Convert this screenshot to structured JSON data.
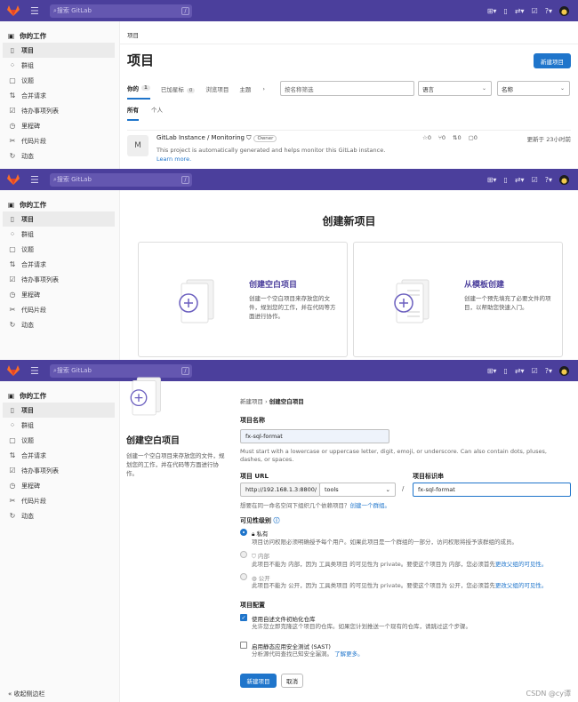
{
  "topbar": {
    "search_placeholder": "搜索 GitLab",
    "search_shortcut": "/"
  },
  "sidebar": {
    "title": "你的工作",
    "items": [
      "项目",
      "群组",
      "议题",
      "合并请求",
      "待办事项列表",
      "里程碑",
      "代码片段",
      "动态"
    ],
    "collapse": "收起侧边栏"
  },
  "projects_page": {
    "breadcrumb": "项目",
    "title": "项目",
    "new_button": "新建项目",
    "tabs": [
      {
        "label": "你的",
        "count": "1"
      },
      {
        "label": "已加星标",
        "count": "0"
      },
      {
        "label": "浏览项目",
        "count": ""
      },
      {
        "label": "主题",
        "count": ""
      }
    ],
    "filter_placeholder": "按名称筛选",
    "language_select": "语言",
    "sort_select": "名称",
    "subtabs": [
      "所有",
      "个人"
    ],
    "project": {
      "avatar": "M",
      "name": "GitLab Instance / Monitoring",
      "role": "Owner",
      "description": "This project is automatically generated and helps monitor this GitLab instance.",
      "learn_more": "Learn more.",
      "stars": "0",
      "forks": "0",
      "merge_requests": "0",
      "issues": "0",
      "updated": "更新于 23小时前"
    }
  },
  "new_project_page": {
    "title": "创建新项目",
    "cards": [
      {
        "title": "创建空白项目",
        "description": "创建一个空白项目来存放您的文件，规划您的工作，并在代码等方面进行协作。"
      },
      {
        "title": "从模板创建",
        "description": "创建一个预先填充了必要文件的项目，以帮助您快速入门。"
      }
    ]
  },
  "blank_project_page": {
    "left_title": "创建空白项目",
    "left_description": "创建一个空白项目来存放您的文件，规划您的工作，并在代码等方面进行协作。",
    "breadcrumb_parent": "新建项目",
    "breadcrumb_current": "创建空白项目",
    "name_label": "项目名称",
    "name_value": "fx-sql-format",
    "name_help": "Must start with a lowercase or uppercase letter, digit, emoji, or underscore. Can also contain dots, pluses, dashes, or spaces.",
    "url_label": "项目 URL",
    "url_prefix": "http://192.168.1.3:8800/",
    "namespace": "tools",
    "slug_label": "项目标识串",
    "slug_value": "fx-sql-format",
    "group_hint": "想要在同一命名空间下组织几个依赖项目？",
    "group_link": "创建一个群组。",
    "visibility_label": "可见性级别",
    "visibility": [
      {
        "label": "私有",
        "description": "项目访问权限必须明确授予每个用户。如果此项目是一个群组的一部分，访问权限将授予该群组的成员。",
        "link": ""
      },
      {
        "label": "内部",
        "description": "此项目不能为 内部，因为 工具类项目 的可见性为 private。要使这个项目为 内部，您必须首先",
        "link": "更改父组的可见性。"
      },
      {
        "label": "公开",
        "description": "此项目不能为 公开，因为 工具类项目 的可见性为 private。要使这个项目为 公开，您必须首先",
        "link": "更改父组的可见性。"
      }
    ],
    "config_label": "项目配置",
    "readme_label": "使用自述文件初始化仓库",
    "readme_help": "允许您立即克隆这个项目的仓库。如果您计划推送一个现有的仓库，请跳过这个步骤。",
    "sast_label": "启用静态应用安全测试 (SAST)",
    "sast_help": "分析源代码查找已知安全漏洞。",
    "sast_link": "了解更多。",
    "create_button": "新建项目",
    "cancel_button": "取消"
  },
  "watermark": "CSDN @cy谭"
}
